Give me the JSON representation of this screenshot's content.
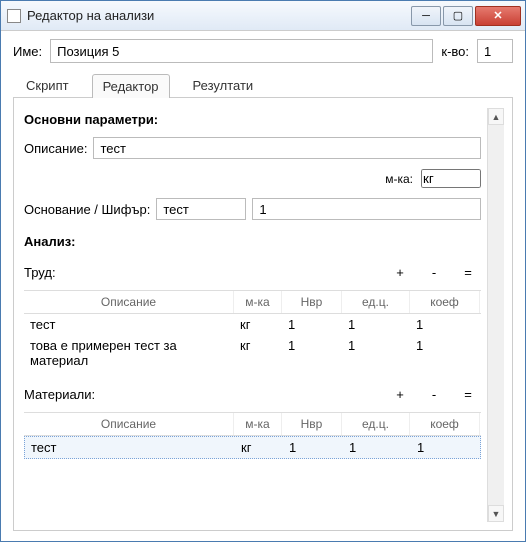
{
  "window": {
    "title": "Редактор на анализи"
  },
  "top": {
    "name_label": "Име:",
    "name_value": "Позиция 5",
    "qty_label": "к-во:",
    "qty_value": "1"
  },
  "tabs": {
    "script": "Скрипт",
    "editor": "Редактор",
    "results": "Резултати"
  },
  "main": {
    "params_title": "Основни параметри:",
    "desc_label": "Описание:",
    "desc_value": "тест",
    "mka_label": "м-ка:",
    "mka_value": "кг",
    "base_label": "Основание / Шифър:",
    "base_value1": "тест",
    "base_value2": "1",
    "analysis_title": "Анализ:",
    "trud_label": "Труд:",
    "materials_label": "Материали:",
    "plus": "+",
    "minus": "-",
    "eq": "=",
    "headers": {
      "c1": "Описание",
      "c2": "м-ка",
      "c3": "Нвр",
      "c4": "ед.ц.",
      "c5": "коеф"
    },
    "trud_rows": [
      {
        "c1": "тест",
        "c2": "кг",
        "c3": "1",
        "c4": "1",
        "c5": "1"
      },
      {
        "c1": "това е примерен тест за материал",
        "c2": "кг",
        "c3": "1",
        "c4": "1",
        "c5": "1"
      }
    ],
    "mat_rows": [
      {
        "c1": "тест",
        "c2": "кг",
        "c3": "1",
        "c4": "1",
        "c5": "1"
      }
    ]
  }
}
